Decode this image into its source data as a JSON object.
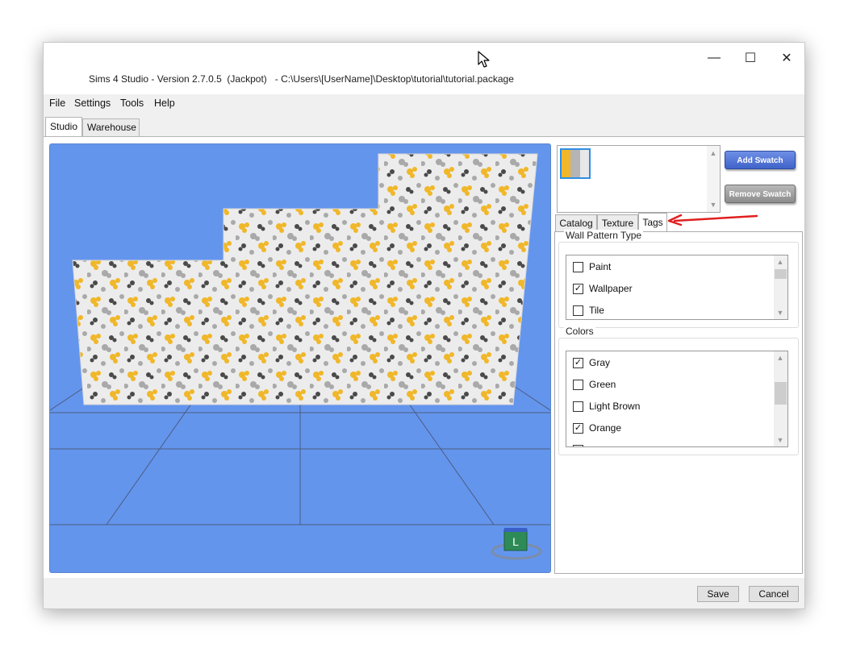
{
  "window": {
    "title": "Sims 4 Studio - Version 2.7.0.5  (Jackpot)   - C:\\Users\\[UserName]\\Desktop\\tutorial\\tutorial.package",
    "minimize_glyph": "—",
    "maximize_glyph": "☐",
    "close_glyph": "✕"
  },
  "menu": [
    "File",
    "Settings",
    "Tools",
    "Help"
  ],
  "tabs": [
    "Studio",
    "Warehouse"
  ],
  "swatches": {
    "add_label": "Add Swatch",
    "remove_label": "Remove Swatch",
    "colors": [
      "#f0b72a",
      "#b5b5b5",
      "#e8e8e8"
    ]
  },
  "subtabs": [
    "Catalog",
    "Texture",
    "Tags"
  ],
  "wall_pattern_type": {
    "title": "Wall Pattern Type",
    "items": [
      {
        "label": "Paint",
        "mark": ""
      },
      {
        "label": "Wallpaper",
        "mark": "✓"
      },
      {
        "label": "Tile",
        "mark": ""
      }
    ]
  },
  "colors_group": {
    "title": "Colors",
    "items": [
      {
        "label": "Gray",
        "mark": "✓"
      },
      {
        "label": "Green",
        "mark": ""
      },
      {
        "label": "Light Brown",
        "mark": ""
      },
      {
        "label": "Orange",
        "mark": "✓"
      }
    ]
  },
  "viewport": {
    "background": "#6495ed",
    "cube_label": "L"
  },
  "footer": {
    "save_label": "Save",
    "cancel_label": "Cancel"
  }
}
